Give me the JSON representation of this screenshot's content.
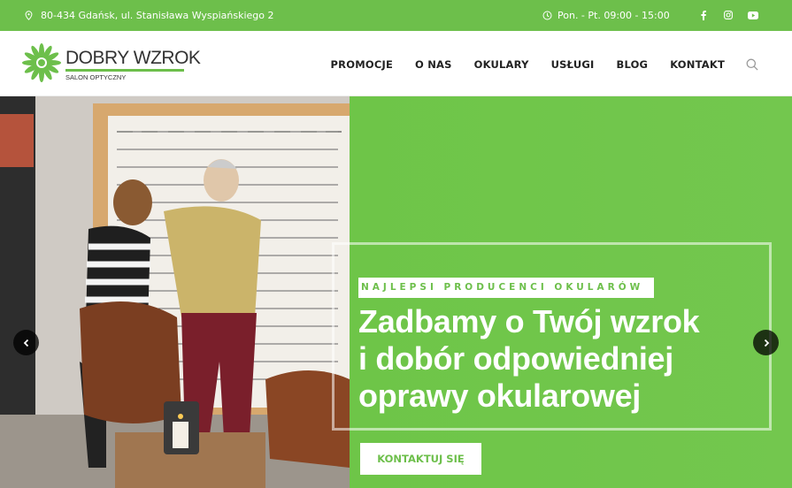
{
  "topbar": {
    "address": "80-434 Gdańsk, ul. Stanisława Wyspiańskiego 2",
    "hours": "Pon. - Pt. 09:00 - 15:00",
    "social": [
      "facebook-icon",
      "instagram-icon",
      "youtube-icon"
    ]
  },
  "logo": {
    "name": "DOBRY WZROK",
    "subtitle": "SALON OPTYCZNY"
  },
  "nav": {
    "items": [
      "PROMOCJE",
      "O NAS",
      "OKULARY",
      "USŁUGI",
      "BLOG",
      "KONTAKT"
    ]
  },
  "hero": {
    "tag": "NAJLEPSI PRODUCENCI OKULARÓW",
    "headline_line1": "Zadbamy o Twój wzrok",
    "headline_line2": "i dobór odpowiedniej",
    "headline_line3": "oprawy okularowej",
    "cta": "KONTAKTUJ SIĘ"
  },
  "colors": {
    "brand_green": "#6dbf4b",
    "text_dark": "#222222"
  }
}
